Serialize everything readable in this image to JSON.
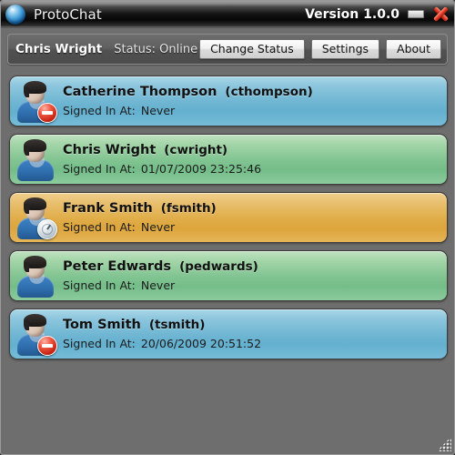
{
  "window": {
    "app_title": "ProtoChat",
    "version_label": "Version 1.0.0",
    "logo_icon": "blue-sphere-icon",
    "minimize_icon": "minimize-icon",
    "close_icon": "close-x-icon",
    "resize_grip_icon": "resize-grip-icon"
  },
  "toolbar": {
    "current_user": "Chris Wright",
    "status_text": "Status: Online",
    "change_status_label": "Change Status",
    "settings_label": "Settings",
    "about_label": "About"
  },
  "list": {
    "signed_in_label": "Signed In At:",
    "contacts": [
      {
        "name": "Catherine Thompson",
        "username": "(cthompson)",
        "signed_in_at": "Never",
        "tone": "tone-blue",
        "badge": "busy",
        "badge_icon": "busy-status-icon",
        "avatar_icon": "user-avatar-icon",
        "color": "#6fb6d2"
      },
      {
        "name": "Chris Wright",
        "username": "(cwright)",
        "signed_in_at": "01/07/2009 23:25:46",
        "tone": "tone-green",
        "badge": "none",
        "badge_icon": "online-status-icon",
        "avatar_icon": "user-avatar-icon",
        "color": "#81c492"
      },
      {
        "name": "Frank Smith",
        "username": "(fsmith)",
        "signed_in_at": "Never",
        "tone": "tone-amber",
        "badge": "away",
        "badge_icon": "away-clock-icon",
        "avatar_icon": "user-avatar-icon",
        "color": "#e0ad49"
      },
      {
        "name": "Peter Edwards",
        "username": "(pedwards)",
        "signed_in_at": "Never",
        "tone": "tone-green",
        "badge": "none",
        "badge_icon": "online-status-icon",
        "avatar_icon": "user-avatar-icon",
        "color": "#81c492"
      },
      {
        "name": "Tom Smith",
        "username": "(tsmith)",
        "signed_in_at": "20/06/2009 20:51:52",
        "tone": "tone-blue",
        "badge": "busy",
        "badge_icon": "busy-status-icon",
        "avatar_icon": "user-avatar-icon",
        "color": "#6fb6d2"
      }
    ]
  }
}
